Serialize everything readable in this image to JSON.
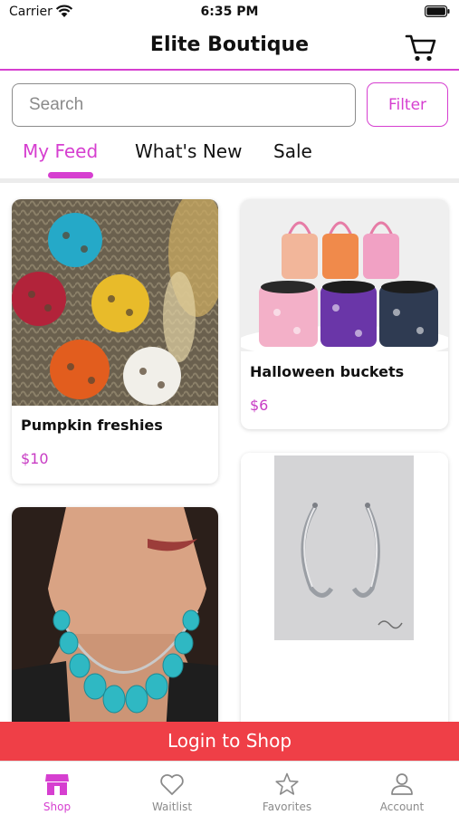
{
  "status_bar": {
    "carrier": "Carrier",
    "time": "6:35 PM"
  },
  "nav": {
    "title": "Elite Boutique"
  },
  "search": {
    "placeholder": "Search",
    "filter_label": "Filter"
  },
  "tabs": [
    {
      "label": "My Feed",
      "active": true
    },
    {
      "label": "What's New",
      "active": false
    },
    {
      "label": "Sale",
      "active": false
    }
  ],
  "products": [
    {
      "name": "Pumpkin freshies",
      "price": "$10"
    },
    {
      "name": "Halloween buckets",
      "price": "$6"
    },
    {
      "name": "",
      "price": ""
    },
    {
      "name": "",
      "price": ""
    }
  ],
  "login_banner": "Login to Shop",
  "tab_bar": [
    {
      "label": "Shop",
      "icon": "shop-icon",
      "active": true
    },
    {
      "label": "Waitlist",
      "icon": "heart-icon",
      "active": false
    },
    {
      "label": "Favorites",
      "icon": "star-icon",
      "active": false
    },
    {
      "label": "Account",
      "icon": "person-icon",
      "active": false
    }
  ],
  "colors": {
    "accent": "#d63fd0",
    "price": "#c83cc4",
    "banner": "#ef3f47",
    "inactive": "#8a8a8a"
  }
}
